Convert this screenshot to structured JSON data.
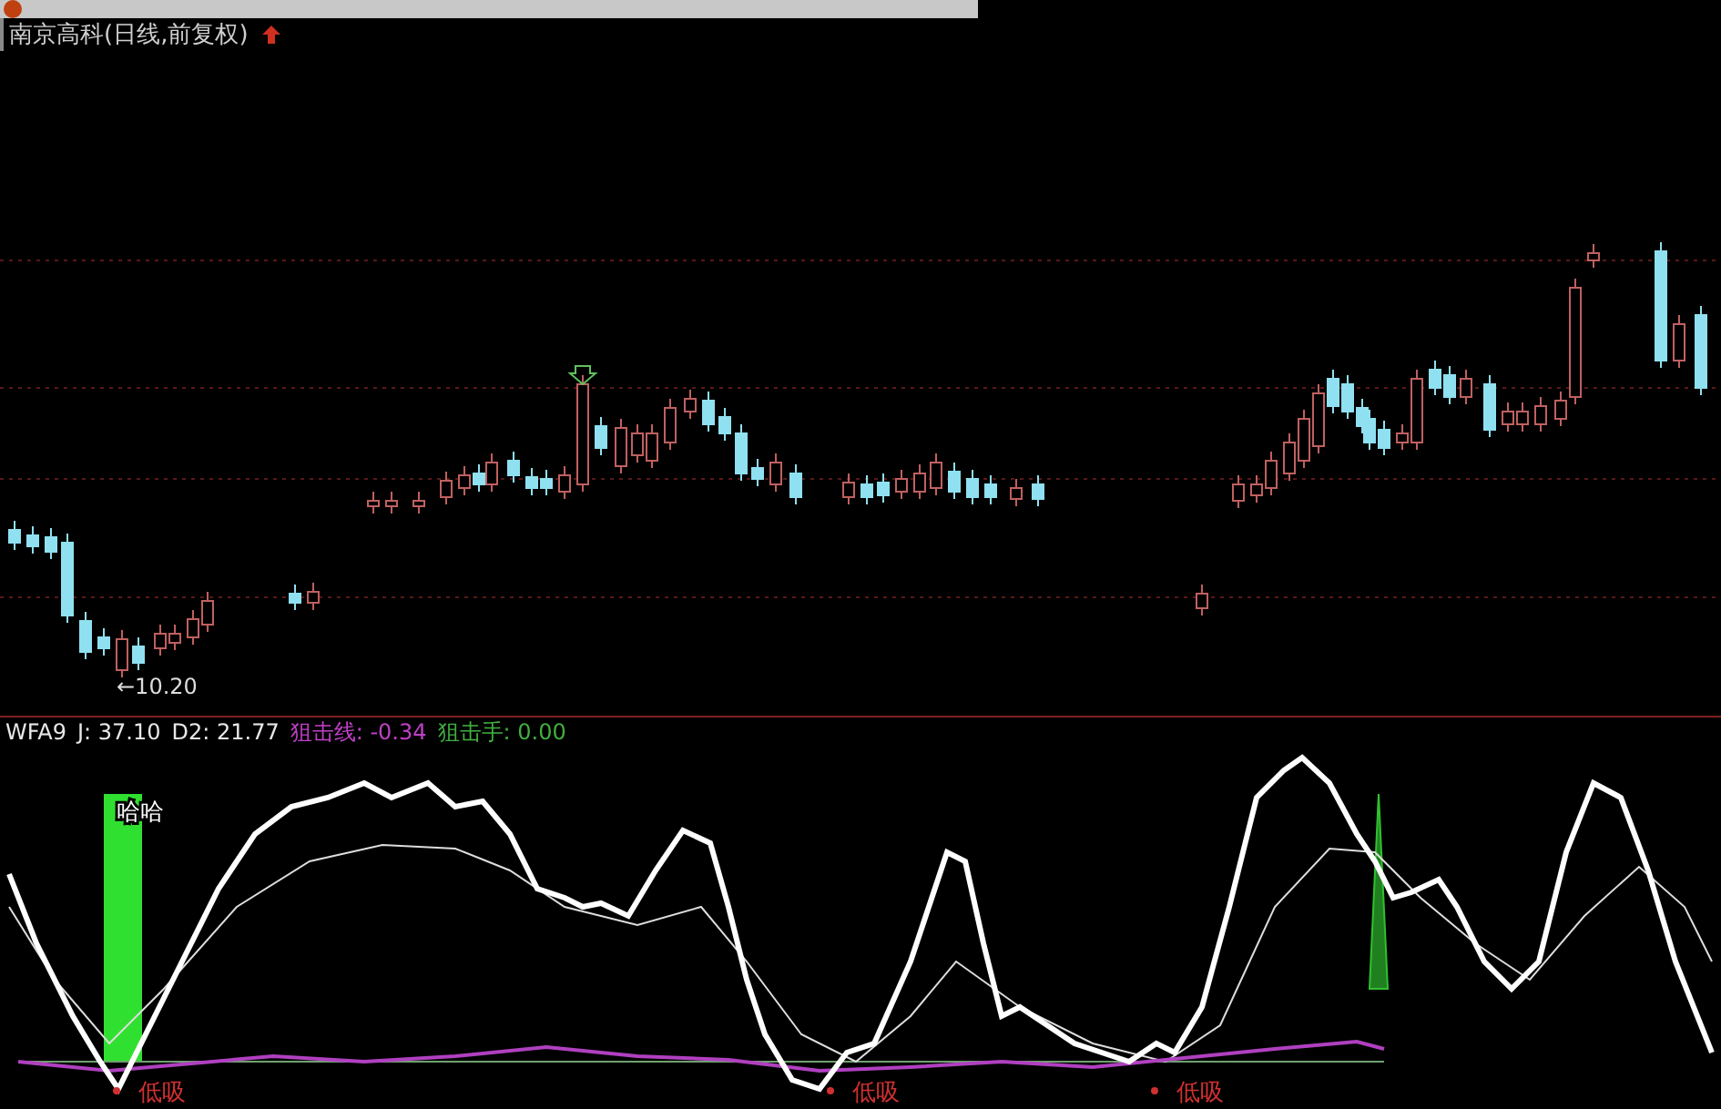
{
  "stock_title": "南京高科(日线,前复权)",
  "price_chart": {
    "low_label": "←10.20"
  },
  "indicator": {
    "name": "WFA9",
    "readings": [
      {
        "label": "J: 37.10",
        "color": "#e8e8e8"
      },
      {
        "label": "D2: 21.77",
        "color": "#e8e8e8"
      },
      {
        "label": "狙击线: -0.34",
        "color": "#c040c8"
      },
      {
        "label": "狙击手: 0.00",
        "color": "#40b040"
      }
    ]
  },
  "signal_label": "哈哈",
  "buy_marks": [
    "低吸",
    "低吸",
    "低吸"
  ]
}
